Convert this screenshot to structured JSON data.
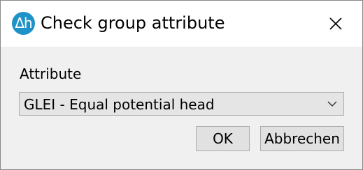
{
  "window": {
    "title": "Check group attribute",
    "app_icon_glyph": "Δh",
    "close_icon": "close-icon"
  },
  "form": {
    "attribute_label": "Attribute",
    "attribute_selected": "GLEI - Equal potential head"
  },
  "buttons": {
    "ok_label": "OK",
    "cancel_label": "Abbrechen"
  },
  "colors": {
    "app_icon": "#1f93c8",
    "dialog_background": "#f0f0f0",
    "titlebar_background": "#ffffff"
  }
}
